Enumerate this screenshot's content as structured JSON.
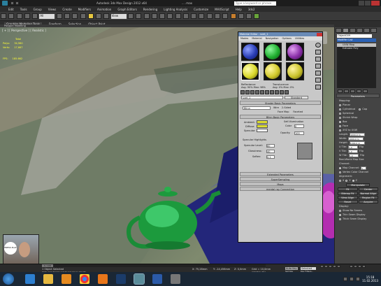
{
  "window": {
    "title": "Autodesk 3ds Max Design 2012 x64",
    "filename": "... .max",
    "search_placeholder": "Type a keyword or phrase",
    "sign_in": "Octane Live 3D"
  },
  "menus": [
    "Edit",
    "Tools",
    "Group",
    "Views",
    "Create",
    "Modifiers",
    "Animation",
    "Graph Editors",
    "Rendering",
    "Lighting Analysis",
    "Customize",
    "MAXScript",
    "Help",
    "3ds2"
  ],
  "toolbar": {
    "selection_filter": "All",
    "view_dropdown": "View"
  },
  "ribbon": {
    "tabs": [
      "Graphite Modeling Tools",
      "Freeform",
      "Selection",
      "Object Paint"
    ],
    "sub": "Polygon Modeling"
  },
  "viewport": {
    "label": "[ + ] [ Perspective ] [ Realistic ]",
    "stats": {
      "total_label": "Total",
      "polys": "Polys:",
      "polys_val": "34,960",
      "verts": "Verts:",
      "verts_val": "17,667",
      "fps": "FPS:",
      "fps_val": "185.662"
    }
  },
  "material_editor": {
    "title": "Material Editor - svet_1",
    "menus": [
      "Modes",
      "Material",
      "Navigation",
      "Options",
      "Utilities"
    ],
    "slot_colors": [
      "#2a3eb5",
      "#20b030",
      "#8a2fa8",
      "#d9d82a",
      "#d0c82a",
      "#c9c22a"
    ],
    "reflectance_label": "Reflectance",
    "reflectance_val": "Avg: 90% Max: 98%",
    "translucence_label": "Translucence",
    "translucence_val": "Avg: 0% Max: 0%",
    "material_name": "svet_1",
    "material_type": "Standard",
    "rollouts": [
      "Shader Basic Parameters",
      "Blinn Basic Parameters",
      "Extended Parameters",
      "SuperSampling",
      "Maps",
      "mental ray Connection"
    ],
    "shader": "Blinn",
    "checks": [
      "Wire",
      "2-Sided",
      "Face Map",
      "Faceted"
    ],
    "ambient": "Ambient:",
    "diffuse": "Diffuse:",
    "specular": "Specular:",
    "self_illum": "Self-Illumination",
    "color_label": "Color",
    "color_val": "0",
    "opacity": "Opacity:",
    "opacity_val": "100",
    "spec_highlights": "Specular Highlights",
    "spec_level": "Specular Level:",
    "spec_level_val": "60",
    "glossiness": "Glossiness:",
    "glossiness_val": "40",
    "soften": "Soften:",
    "soften_val": "0.1"
  },
  "command_panel": {
    "object_name": "Object009",
    "modifier_list": "Modifier List",
    "stack": [
      "UVW Map",
      "Editable Poly"
    ],
    "rollout": "Parameters",
    "mapping_label": "Mapping:",
    "mapping": [
      "Planar",
      "Cylindrical",
      "Cap",
      "Spherical",
      "Shrink Wrap",
      "Box",
      "Face",
      "XYZ to UVW"
    ],
    "length": "Length:",
    "length_val": "1000,0 m",
    "width": "Width:",
    "width_val": "1000,0 m",
    "height": "Height:",
    "height_val": "1000,0 m",
    "utile": "U Tile:",
    "utile_val": "1,0",
    "vtile": "V Tile:",
    "vtile_val": "1,0",
    "wtile": "W Tile:",
    "wtile_val": "1,0",
    "flip": "Flip",
    "realworld": "Real-World Map Size",
    "channel": "Channel:",
    "map_channel": "Map Channel:",
    "map_channel_val": "1",
    "vertex_color": "Vertex Color Channel",
    "alignment": "Alignment:",
    "axes": [
      "X",
      "Y",
      "Z"
    ],
    "manipulate": "Manipulate",
    "buttons": [
      "Fit",
      "Center",
      "Bitmap Fit",
      "Normal Align",
      "View Align",
      "Region Fit",
      "Reset",
      "Acquire"
    ],
    "display": "Display:",
    "display_opts": [
      "Show No Seams",
      "Thin Seam Display",
      "Thick Seam Display"
    ]
  },
  "status": {
    "selected": "1 Object Selected",
    "hint": "Click and drag to select and move objects",
    "x": "X: 75,28mm",
    "y": "Y: -14,456mm",
    "z": "Z: 0,0mm",
    "grid": "Grid = 10,0mm",
    "autokey": "Auto Key",
    "selected_drop": "Selected",
    "add_time": "Add Time Tag",
    "set_key": "Set Key",
    "key_filters": "Key Filters...",
    "frame": "0 / 100"
  },
  "taskbar": {
    "time": "15:18",
    "date": "11.02.2013",
    "apps": [
      "start",
      "ie",
      "explorer",
      "media",
      "chrome",
      "firefox",
      "photoshop",
      "3dsmax",
      "word",
      "app"
    ]
  },
  "webcam": {
    "caption": "PRESS PLAY"
  }
}
